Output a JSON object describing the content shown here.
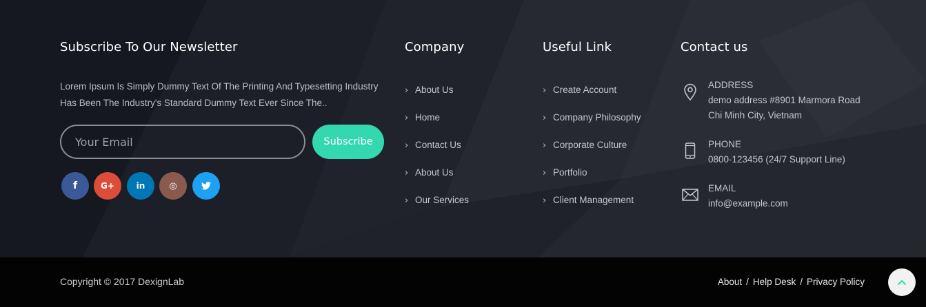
{
  "newsletter": {
    "title": "Subscribe To Our Newsletter",
    "description": "Lorem Ipsum Is Simply Dummy Text Of The Printing And Typesetting Industry Has Been The Industry's Standard Dummy Text Ever Since The..",
    "email_placeholder": "Your Email",
    "subscribe_label": "Subscribe"
  },
  "social": [
    {
      "name": "facebook",
      "glyph": "f",
      "color": "#3b5998"
    },
    {
      "name": "google-plus",
      "glyph": "G+",
      "color": "#dd4b39"
    },
    {
      "name": "linkedin",
      "glyph": "in",
      "color": "#0077b5"
    },
    {
      "name": "instagram",
      "glyph": "◎",
      "color": "#8a5a4e"
    },
    {
      "name": "twitter",
      "glyph": "t",
      "color": "#1da1f2"
    }
  ],
  "company": {
    "title": "Company",
    "items": [
      "About Us",
      "Home",
      "Contact Us",
      "About Us",
      "Our Services"
    ]
  },
  "useful": {
    "title": "Useful Link",
    "items": [
      "Create Account",
      "Company Philosophy",
      "Corporate Culture",
      "Portfolio",
      "Client Management"
    ]
  },
  "contact": {
    "title": "Contact us",
    "address_label": "ADDRESS",
    "address_line1": "demo address #8901 Marmora Road",
    "address_line2": "Chi Minh City, Vietnam",
    "phone_label": "PHONE",
    "phone_value": "0800-123456 (24/7 Support Line)",
    "email_label": "EMAIL",
    "email_value": "info@example.com"
  },
  "bottom": {
    "copyright": "Copyright © 2017 DexignLab",
    "links": [
      "About",
      "Help Desk",
      "Privacy Policy"
    ],
    "separator": "/"
  },
  "colors": {
    "top_bg": "#1a1d24",
    "bottom_bg": "#030303",
    "accent": "#33d8b0"
  },
  "icons": [
    "chevron-right-icon",
    "map-pin-icon",
    "mobile-phone-icon",
    "envelope-icon",
    "chevron-up-icon"
  ]
}
